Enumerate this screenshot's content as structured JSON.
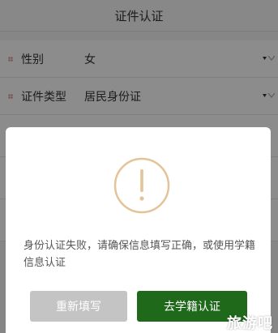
{
  "page": {
    "title": "证件认证"
  },
  "form": {
    "rows": [
      {
        "label": "性别",
        "value": "女"
      },
      {
        "label": "证件类型",
        "value": "居民身份证"
      }
    ]
  },
  "dialog": {
    "message": "身份认证失败，请确保信息填写正确，或使用学籍信息认证",
    "buttons": {
      "refill": "重新填写",
      "xueji": "去学籍认证"
    }
  },
  "watermark": {
    "text": "旅游吧"
  },
  "colors": {
    "accent_green": "#1f6a1a",
    "alert_orange": "#e4c39a",
    "button_gray": "#c4c4c4",
    "required_marker": "#d88a8a"
  }
}
